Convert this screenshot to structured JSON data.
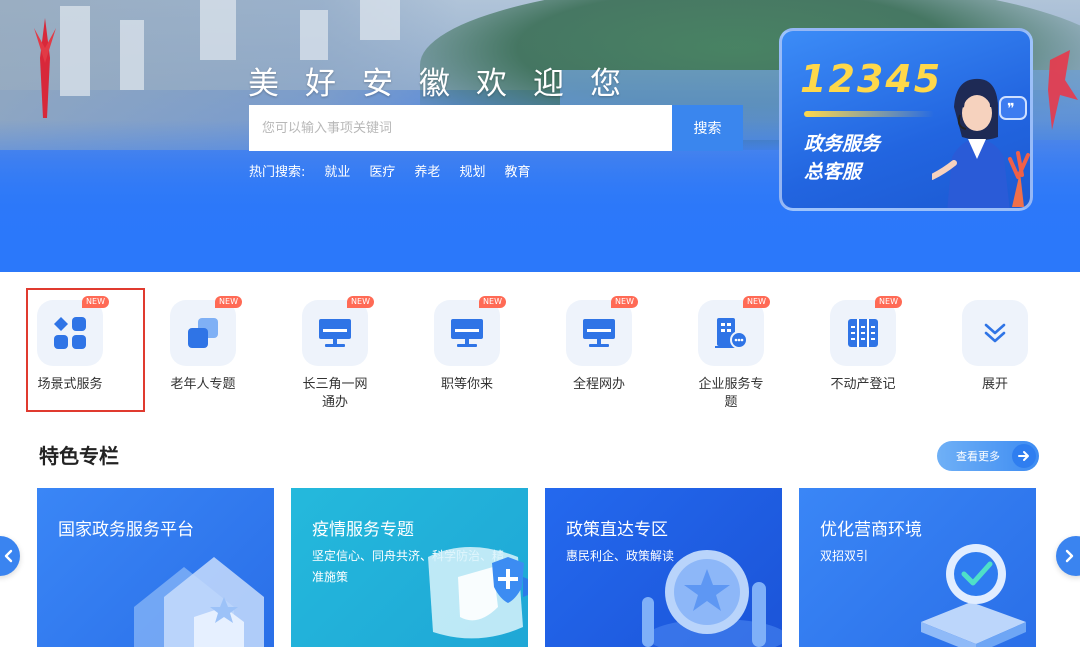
{
  "hero": {
    "slogan": "美好安徽欢迎您",
    "search": {
      "placeholder": "您可以输入事项关键词",
      "button": "搜索"
    },
    "hot_search": {
      "label": "热门搜索:",
      "keywords": [
        "就业",
        "医疗",
        "养老",
        "规划",
        "教育"
      ]
    },
    "hotline": {
      "number": "12345",
      "line1": "政务服务",
      "line2": "总客服"
    }
  },
  "services": [
    {
      "label": "场景式服务",
      "badge": "NEW",
      "icon": "grid-apps-icon"
    },
    {
      "label": "老年人专题",
      "badge": "NEW",
      "icon": "stacked-squares-icon"
    },
    {
      "label": "长三角一网通办",
      "label_line2": "通办",
      "badge": "NEW",
      "icon": "monitor-icon"
    },
    {
      "label": "职等你来",
      "badge": "NEW",
      "icon": "monitor-icon"
    },
    {
      "label": "全程网办",
      "badge": "NEW",
      "icon": "monitor-icon"
    },
    {
      "label": "企业服务专题",
      "badge": "NEW",
      "icon": "building-chat-icon"
    },
    {
      "label": "不动产登记",
      "badge": "NEW",
      "icon": "ledger-icon"
    },
    {
      "label": "展开",
      "icon": "double-chevron-down-icon"
    }
  ],
  "labels": {
    "s3_line1": "长三角一网",
    "s3_line2": "通办",
    "s6_line1": "企业服务专",
    "s6_line2": "题"
  },
  "featured": {
    "title": "特色专栏",
    "more": "查看更多",
    "cards": [
      {
        "title": "国家政务服务平台",
        "subtitle": "",
        "color": "#2f7cf4"
      },
      {
        "title": "疫情服务专题",
        "subtitle": "坚定信心、同舟共济、科学防治、精准施策",
        "color": "#22b4d8"
      },
      {
        "title": "政策直达专区",
        "subtitle": "惠民利企、政策解读",
        "color": "#1f5fe6"
      },
      {
        "title": "优化营商环境",
        "subtitle": "双招双引",
        "color": "#2f7cf4"
      }
    ]
  },
  "colors": {
    "accent": "#3a86ee",
    "badge": "#ff6a55",
    "highlight": "#e03a2f"
  }
}
